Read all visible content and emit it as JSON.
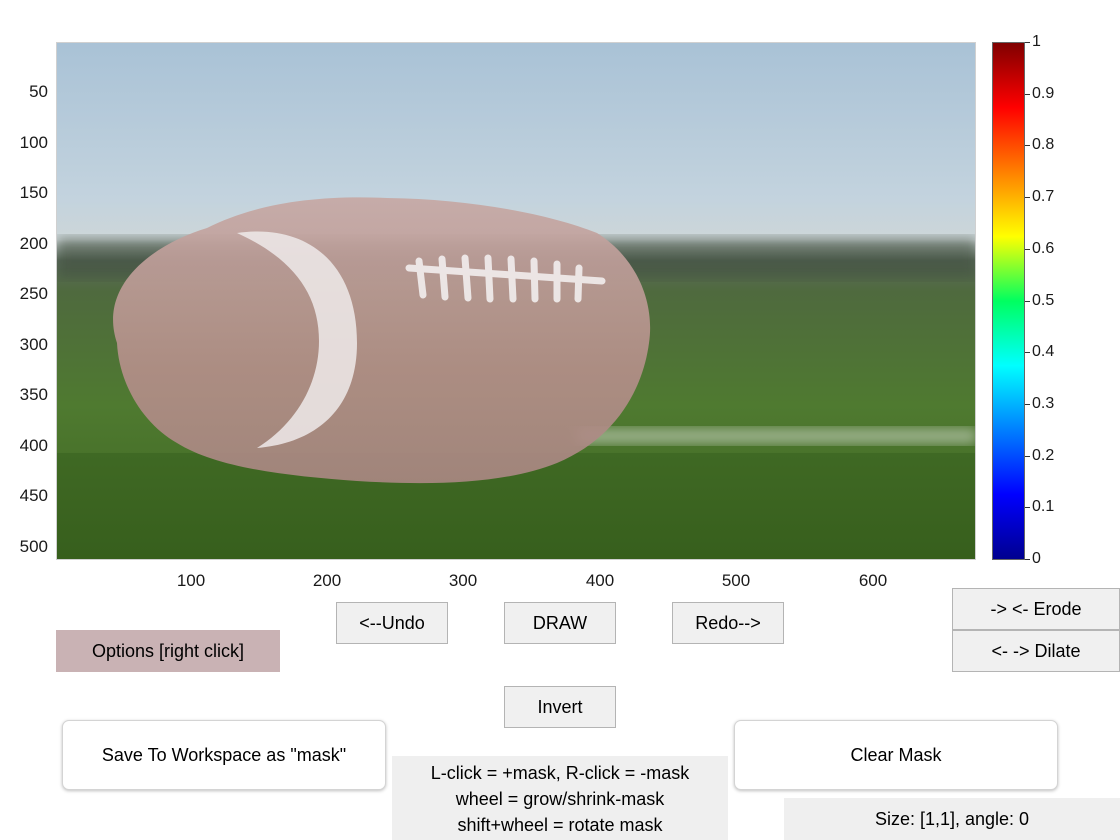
{
  "image": {
    "y_ticks": [
      "50",
      "100",
      "150",
      "200",
      "250",
      "300",
      "350",
      "400",
      "450",
      "500"
    ],
    "x_ticks": [
      "100",
      "200",
      "300",
      "400",
      "500",
      "600"
    ]
  },
  "colorbar": {
    "ticks": [
      "0",
      "0.1",
      "0.2",
      "0.3",
      "0.4",
      "0.5",
      "0.6",
      "0.7",
      "0.8",
      "0.9",
      "1"
    ],
    "colormap": "jet"
  },
  "buttons": {
    "undo": "<--Undo",
    "draw": "DRAW",
    "redo": "Redo-->",
    "erode": "-> <- Erode",
    "dilate": "<- -> Dilate",
    "options": "Options [right click]",
    "invert": "Invert",
    "save": "Save To Workspace as \"mask\"",
    "clear": "Clear Mask"
  },
  "instructions": {
    "line1": "L-click = +mask, R-click = -mask",
    "line2": "wheel = grow/shrink-mask",
    "line3": "shift+wheel = rotate mask"
  },
  "status": "Size: [1,1], angle: 0",
  "colors": {
    "options_bg": "#c9b2b4",
    "button_bg": "#f0f0f0"
  }
}
